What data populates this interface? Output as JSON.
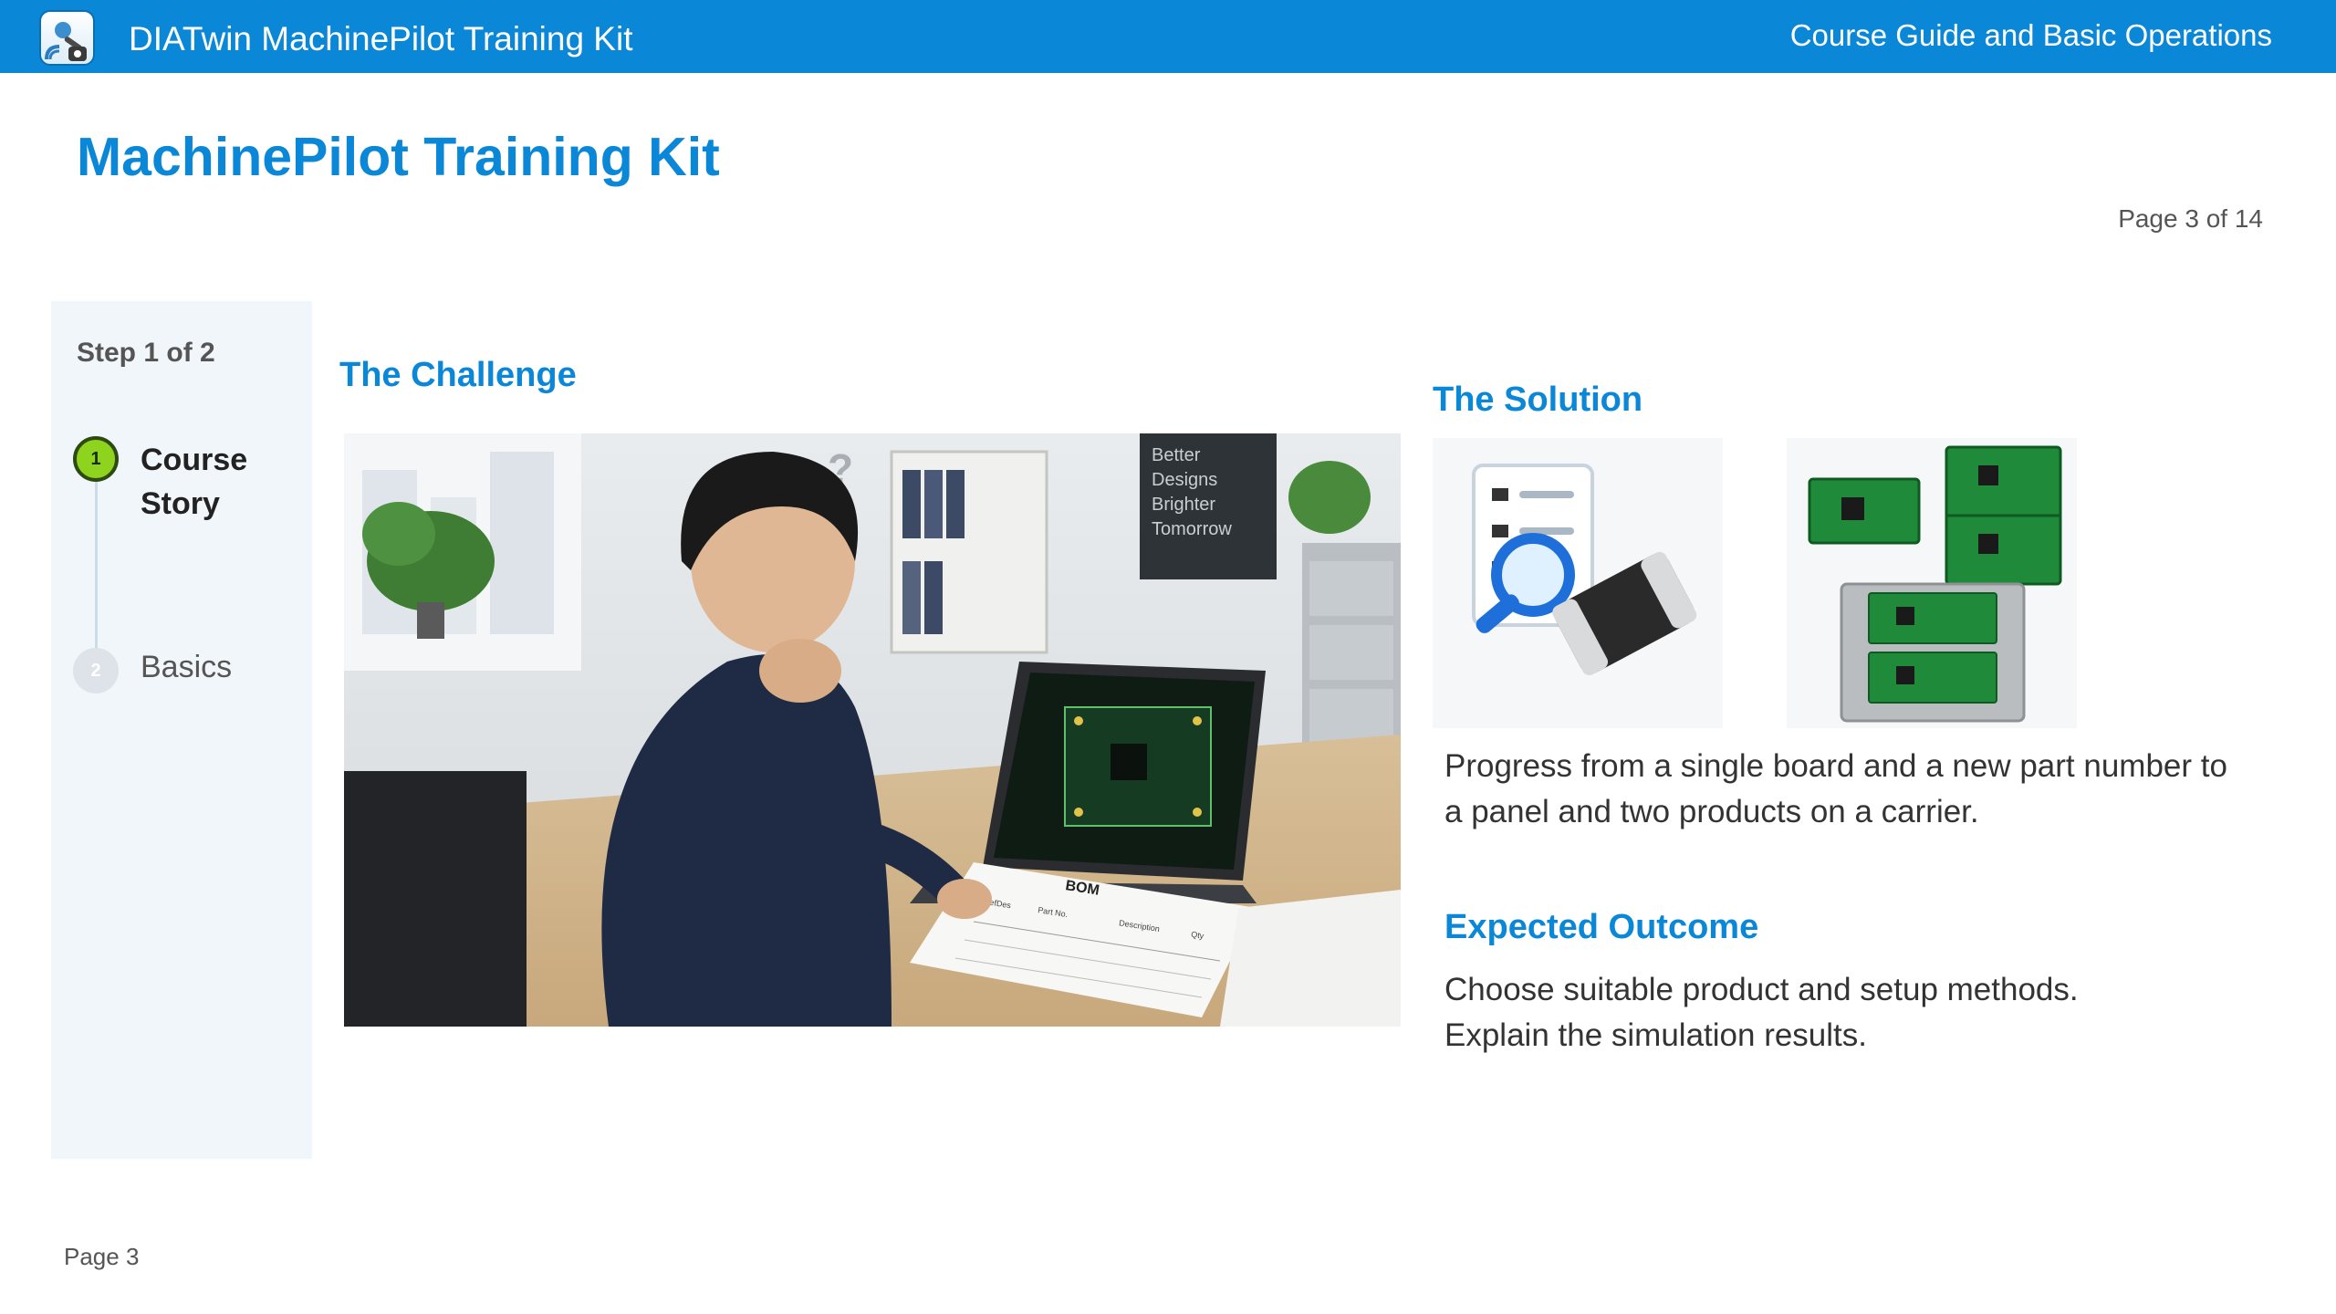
{
  "header": {
    "app_title": "DIATwin MachinePilot Training Kit",
    "section": "Course Guide and Basic Operations",
    "logo_icon": "machinepilot-logo-icon"
  },
  "page": {
    "title": "MachinePilot Training Kit",
    "counter": "Page 3 of 14",
    "footer": "Page 3"
  },
  "steps": {
    "heading": "Step 1 of 2",
    "items": [
      {
        "number": "1",
        "label": "Course Story",
        "active": true
      },
      {
        "number": "2",
        "label": "Basics",
        "active": false
      }
    ]
  },
  "challenge": {
    "title": "The Challenge",
    "image_text": {
      "question_mark": "?",
      "poster": [
        "Better",
        "Designs",
        "Brighter",
        "Tomorrow"
      ],
      "document_title": "BOM",
      "bom_columns": [
        "RefDes",
        "Part No.",
        "Description",
        "Qty"
      ]
    }
  },
  "solution": {
    "title": "The Solution",
    "text": "Progress from a single board and a new part number to a panel and two products on a carrier.",
    "image_icons": [
      "checklist-magnifier-icon",
      "pcb-panel-carrier-icon"
    ]
  },
  "outcome": {
    "title": "Expected Outcome",
    "lines": [
      "Choose suitable product and setup methods.",
      "Explain the simulation results."
    ]
  },
  "colors": {
    "header_blue": "#0b87d8",
    "heading_blue": "#0b87d8",
    "active_step_green": "#8ed41e",
    "panel_bg": "#f1f6fa",
    "pcb_green": "#1f8a3a"
  }
}
